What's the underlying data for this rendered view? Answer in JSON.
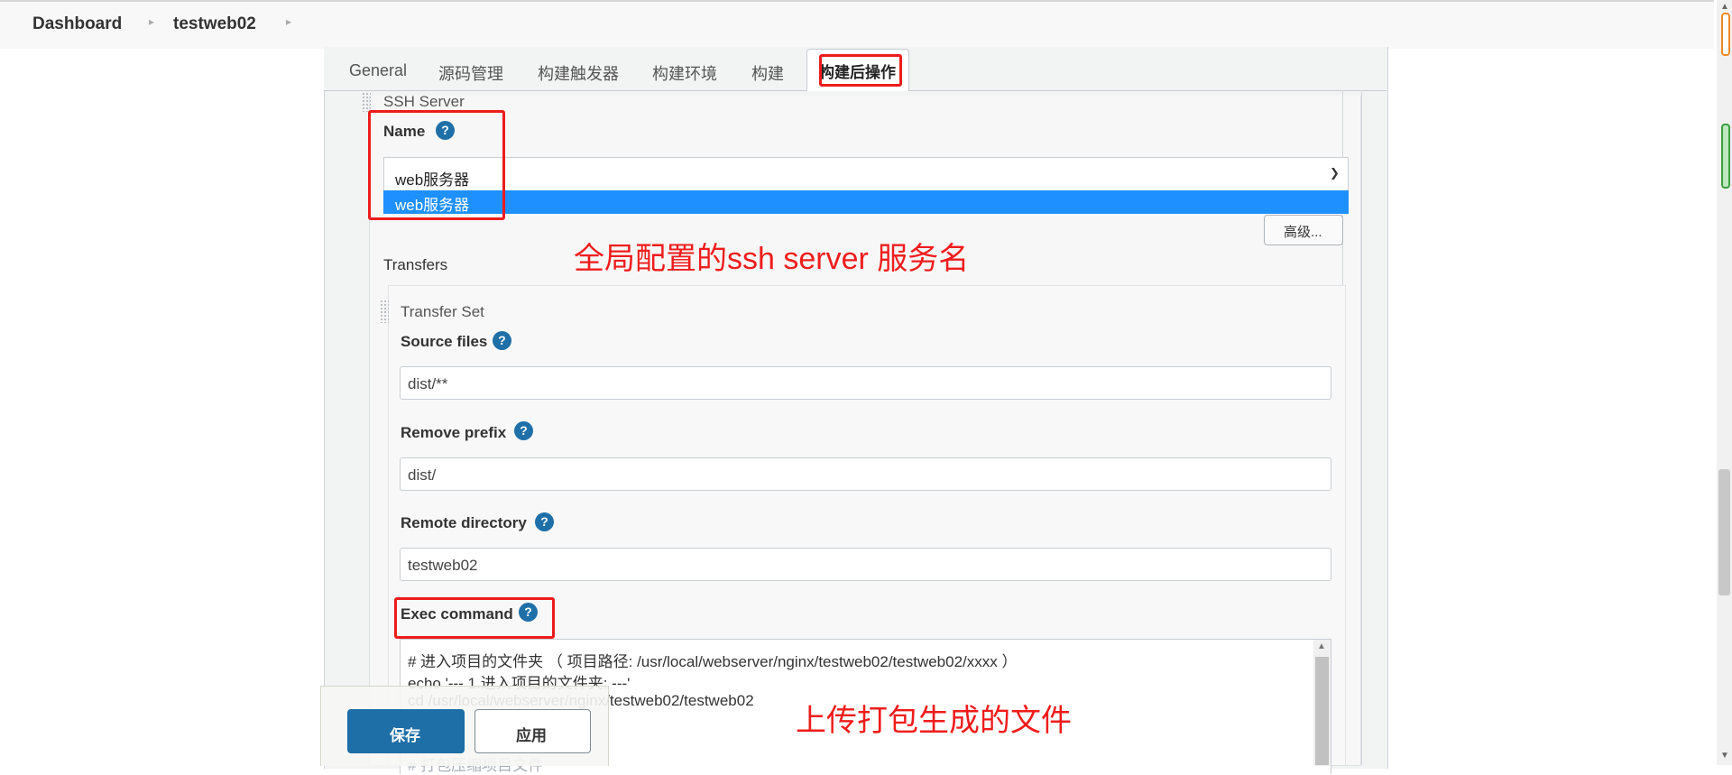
{
  "breadcrumb": {
    "items": [
      "Dashboard",
      "testweb02"
    ]
  },
  "tabs": [
    "General",
    "源码管理",
    "构建触发器",
    "构建环境",
    "构建",
    "构建后操作"
  ],
  "ssh_server": {
    "section_label": "SSH Server",
    "name_label": "Name",
    "name_value": "web服务器",
    "dropdown_options": [
      "web服务器"
    ],
    "advanced_button": "高级..."
  },
  "transfers": {
    "label": "Transfers",
    "set_label": "Transfer Set",
    "source_files": {
      "label": "Source files",
      "value": "dist/**"
    },
    "remove_prefix": {
      "label": "Remove prefix",
      "value": "dist/"
    },
    "remote_directory": {
      "label": "Remote directory",
      "value": "testweb02"
    },
    "exec_command": {
      "label": "Exec command",
      "lines": [
        "# 进入项目的文件夹 （ 项目路径: /usr/local/webserver/nginx/testweb02/testweb02/xxxx ）",
        "echo '--- 1.进入项目的文件夹: ---'",
        "cd /usr/local/webserver/nginx/testweb02/testweb02",
        "# 打包压缩项目文件"
      ]
    }
  },
  "footer": {
    "save": "保存",
    "apply": "应用"
  },
  "annotations": {
    "server_note": "全局配置的ssh server 服务名",
    "upload_note": "上传打包生成的文件",
    "color": "#ee1c1c"
  },
  "help_glyph": "?",
  "icons": {
    "breadcrumb_separator": "chevron-right-icon",
    "select_arrow": "chevron-down-icon",
    "help": "help-circle-icon",
    "drag_handle": "drag-handle-icon"
  }
}
